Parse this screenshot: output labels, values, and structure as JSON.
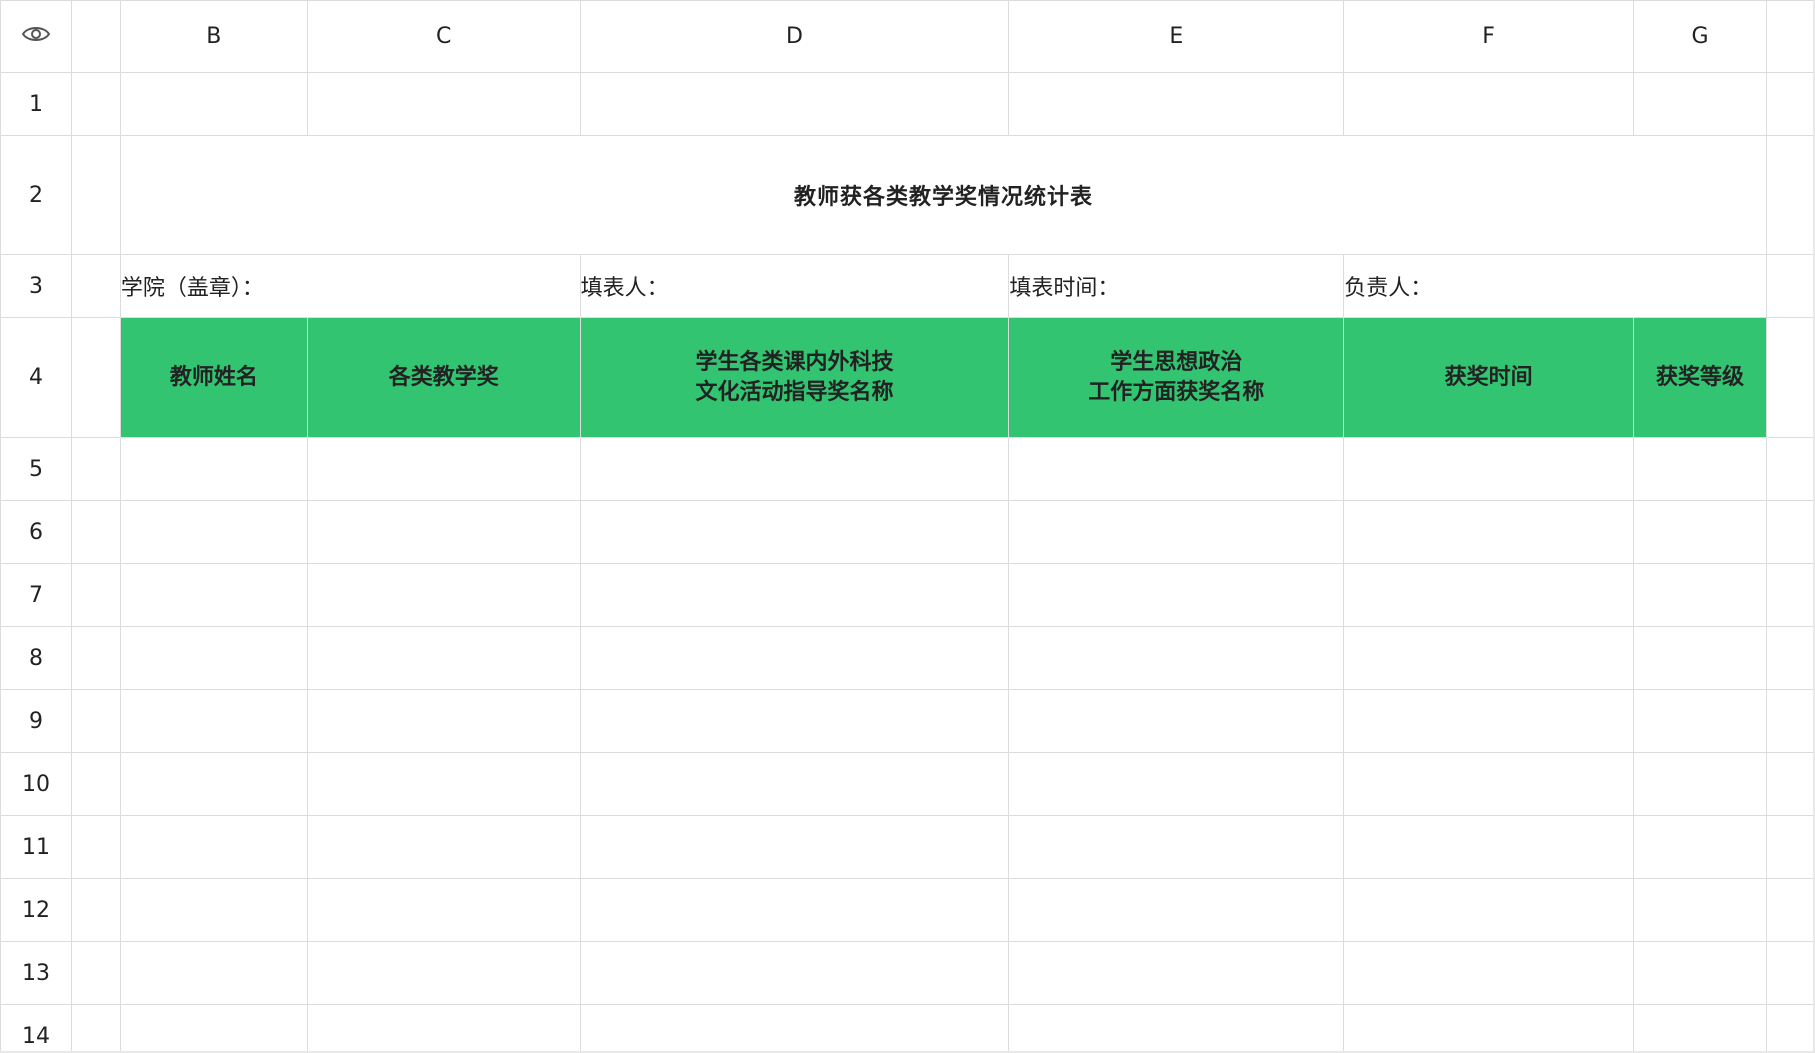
{
  "grid": {
    "columns": [
      "",
      "B",
      "C",
      "D",
      "E",
      "F",
      "G",
      ""
    ],
    "rows": [
      "1",
      "2",
      "3",
      "4",
      "5",
      "6",
      "7",
      "8",
      "9",
      "10",
      "11",
      "12",
      "13",
      "14"
    ]
  },
  "sheet": {
    "title": "教师获各类教学奖情况统计表",
    "meta": {
      "college": "学院（盖章）：",
      "filler": "填表人：",
      "fill_time": "填表时间：",
      "responsible": "负责人："
    },
    "headers": [
      {
        "lines": [
          "教师姓名"
        ]
      },
      {
        "lines": [
          "各类教学奖"
        ]
      },
      {
        "lines": [
          "学生各类课内外科技",
          "文化活动指导奖名称"
        ]
      },
      {
        "lines": [
          "学生思想政治",
          "工作方面获奖名称"
        ]
      },
      {
        "lines": [
          "获奖时间"
        ]
      },
      {
        "lines": [
          "获奖等级"
        ]
      }
    ]
  },
  "colors": {
    "header_green": "#33c472",
    "grid_line": "#dcdcdc",
    "text": "#222222"
  },
  "icons": {
    "corner": "eye-icon"
  }
}
